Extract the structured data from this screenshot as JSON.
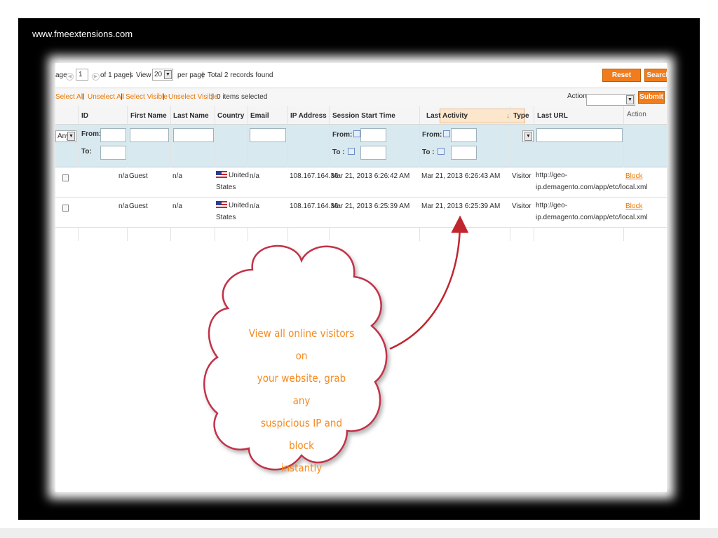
{
  "site_url": "www.fmeextensions.com",
  "pager": {
    "page_label": "age",
    "page_value": "1",
    "of_pages": "of 1 pages",
    "view_label": "View",
    "per_page_value": "20",
    "per_page_label": "per page",
    "records_found": "Total 2 records found",
    "reset_filter": "Reset Filter",
    "search": "Search"
  },
  "massaction": {
    "select_all": "Select All",
    "unselect_all": "Unselect All",
    "select_visible": "Select Visible",
    "unselect_visible": "Unselect Visible",
    "items_selected": "0 items selected",
    "actions_label": "Actions",
    "actions_value": "",
    "submit": "Submit"
  },
  "columns": [
    "ID",
    "First Name",
    "Last Name",
    "Country",
    "Email",
    "IP Address",
    "Session Start Time",
    "Last Activity",
    "Type",
    "Last URL",
    "Action"
  ],
  "filters": {
    "checkbox_any": "Any",
    "from": "From:",
    "to": "To:",
    "from_short": "From:",
    "to_short": "To :"
  },
  "rows": [
    {
      "id": "n/a",
      "first_name": "Guest",
      "last_name": "n/a",
      "country_line1": "United",
      "country_line2": "States",
      "email": "n/a",
      "ip": "108.167.164.36",
      "session_start": "Mar 21, 2013 6:26:42 AM",
      "last_activity": "Mar 21, 2013 6:26:43 AM",
      "type": "Visitor",
      "url_line1": "http://geo-",
      "url_line2": "ip.demagento.com/app/etc/local.xml",
      "action": "Block"
    },
    {
      "id": "n/a",
      "first_name": "Guest",
      "last_name": "n/a",
      "country_line1": "United",
      "country_line2": "States",
      "email": "n/a",
      "ip": "108.167.164.36",
      "session_start": "Mar 21, 2013 6:25:39 AM",
      "last_activity": "Mar 21, 2013 6:25:39 AM",
      "type": "Visitor",
      "url_line1": "http://geo-",
      "url_line2": "ip.demagento.com/app/etc/local.xml",
      "action": "Block"
    }
  ],
  "callout": {
    "line1": "View all online visitors on",
    "line2": "your website, grab any",
    "line3": "suspicious IP and block",
    "line4": "instantly"
  },
  "colors": {
    "accent": "#f07c1d",
    "filter_bg": "#d9e9f0",
    "cloud_border": "#c2334a",
    "arrow": "#c0262e"
  },
  "icons": [
    "calendar-icon",
    "dropdown-arrow-icon",
    "us-flag-icon",
    "pager-prev-icon",
    "pager-next-icon"
  ]
}
